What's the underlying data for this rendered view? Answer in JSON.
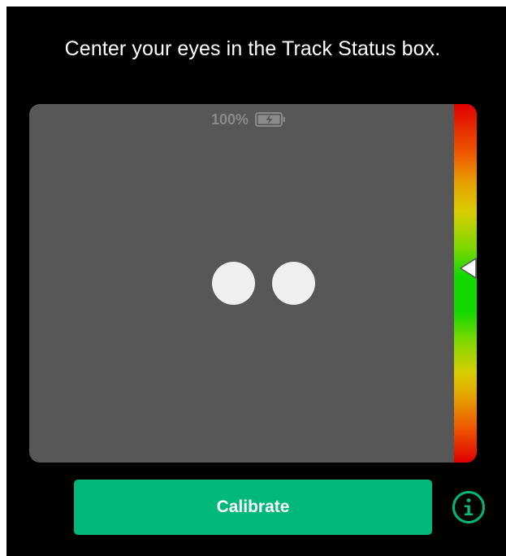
{
  "instruction": "Center your eyes in the Track Status box.",
  "track_box": {
    "battery": {
      "percent_label": "100%",
      "icon": "battery-charging-icon"
    },
    "eyes": [
      {
        "name": "left-eye"
      },
      {
        "name": "right-eye"
      }
    ],
    "status_bar": {
      "icon": "triangle-marker-icon",
      "colors": [
        "#e00000",
        "#ee5a00",
        "#d8cc00",
        "#12d800"
      ]
    }
  },
  "actions": {
    "calibrate_label": "Calibrate",
    "calibrate_color": "#00b87a",
    "info_icon": "info-icon"
  }
}
